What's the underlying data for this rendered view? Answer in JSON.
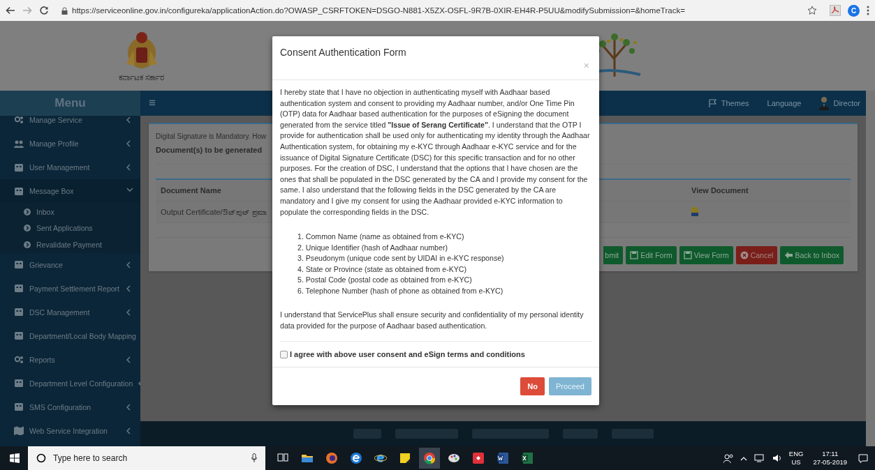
{
  "browser": {
    "url": "https://serviceonline.gov.in/configureka/applicationAction.do?OWASP_CSRFTOKEN=DSGO-N881-X5ZX-OSFL-9R7B-0XIR-EH4R-P5UU&modifySubmission=&homeTrack=",
    "profile_initial": "C"
  },
  "header": {
    "left_caption": "ಕರ್ನಾಟಕ ಸರ್ಕಾರ"
  },
  "navbar": {
    "menu_title": "Menu",
    "toggle": "≡",
    "links": [
      {
        "label": "Themes",
        "kind": "flag"
      },
      {
        "label": "Language",
        "kind": "text"
      },
      {
        "label": "Director",
        "kind": "user"
      }
    ]
  },
  "sidebar": {
    "items": [
      {
        "label": "Manage Service",
        "expanded": false
      },
      {
        "label": "Manage Profile",
        "expanded": false
      },
      {
        "label": "User Management",
        "expanded": false
      },
      {
        "label": "Message Box",
        "expanded": true,
        "children": [
          {
            "label": "Inbox"
          },
          {
            "label": "Sent Applications"
          },
          {
            "label": "Revalidate Payment"
          }
        ]
      },
      {
        "label": "Grievance",
        "expanded": false
      },
      {
        "label": "Payment Settlement Report",
        "expanded": false
      },
      {
        "label": "DSC Management",
        "expanded": false
      },
      {
        "label": "Department/Local Body Mapping",
        "expanded": false
      },
      {
        "label": "Reports",
        "expanded": false
      },
      {
        "label": "Department Level Configuration",
        "expanded": false
      },
      {
        "label": "SMS Configuration",
        "expanded": false
      },
      {
        "label": "Web Service Integration",
        "expanded": false
      }
    ]
  },
  "main": {
    "notice": "Digital Signature is Mandatory. How",
    "section_title": "Document(s) to be generated",
    "table": {
      "columns": [
        "Document Name",
        "View Document"
      ],
      "rows": [
        {
          "cells": [
            "Output Certificate/ಔಟ್‌ಪುಟ್ ಪ್ರಮಾ"
          ],
          "has_document": true
        }
      ]
    },
    "buttons": [
      {
        "label": "bmit",
        "kind": "submit"
      },
      {
        "label": "Edit Form",
        "kind": "edit"
      },
      {
        "label": "View Form",
        "kind": "view"
      },
      {
        "label": "Cancel",
        "kind": "cancel"
      },
      {
        "label": "Back to Inbox",
        "kind": "back"
      }
    ]
  },
  "modal": {
    "title": "Consent Authentication Form",
    "close": "×",
    "intro": "I hereby state that I have no objection in authenticating myself with Aadhaar based authentication system and consent to providing my Aadhaar number, and/or One Time Pin (OTP) data for Aadhaar based authentication for the purposes of eSigning the document generated from the service titled **\"Issue of Serang Certificate\"**. I understand that the OTP I provide for authentication shall be used only for authenticating my identity through the Aadhaar Authentication system, for obtaining my e-KYC through Aadhaar e-KYC service and for the issuance of Digital Signature Certificate (DSC) for this specific transaction and for no other purposes. For the creation of DSC, I understand that the options that I have chosen are the ones that shall be populated in the DSC generated by the CA and I provide my consent for the same. I also understand that the following fields in the DSC generated by the CA are mandatory and I give my consent for using the Aadhaar provided e-KYC information to populate the corresponding fields in the DSC.",
    "fields": [
      "1. Common Name (name as obtained from e-KYC)",
      "2. Unique Identifier (hash of Aadhaar number)",
      "3. Pseudonym (unique code sent by UIDAI in e-KYC response)",
      "4. State or Province (state as obtained from e-KYC)",
      "5. Postal Code (postal code as obtained from e-KYC)",
      "6. Telephone Number (hash of phone as obtained from e-KYC)"
    ],
    "outro": "I understand that ServicePlus shall ensure security and confidentiality of my personal identity data provided for the purpose of Aadhaar based authentication.",
    "agree": {
      "label": "I agree with above user consent and eSign terms and conditions",
      "checked": false
    },
    "buttons": [
      {
        "label": "No",
        "kind": "danger",
        "disabled": false
      },
      {
        "label": "Proceed",
        "kind": "primary",
        "disabled": true
      }
    ]
  },
  "taskbar": {
    "search_placeholder": "Type here to search",
    "language": "ENG",
    "region": "US",
    "time": "17:11",
    "date": "27-05-2019"
  }
}
